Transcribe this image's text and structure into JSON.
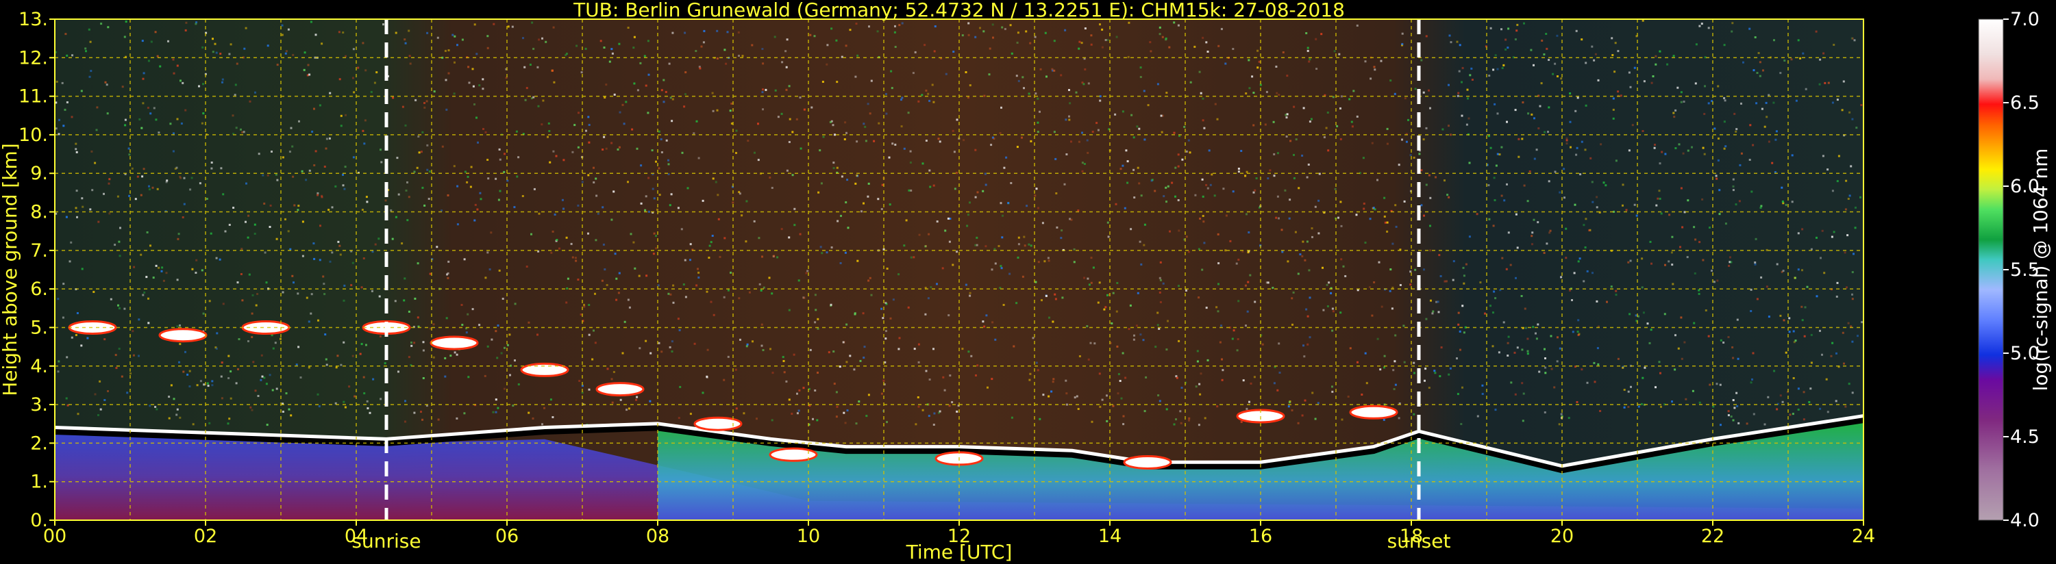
{
  "chart_data": {
    "type": "heatmap",
    "title": "TUB: Berlin Grunewald (Germany; 52.4732 N / 13.2251 E):    CHM15k: 27-08-2018",
    "xlabel": "Time [UTC]",
    "ylabel": "Height above ground [km]",
    "colorbar_label": "log(rc-signal) @ 1064 nm",
    "xlim": [
      0,
      24
    ],
    "ylim": [
      0,
      13
    ],
    "x_ticks": [
      "00",
      "02",
      "04",
      "06",
      "08",
      "10",
      "12",
      "14",
      "16",
      "18",
      "20",
      "22",
      "24"
    ],
    "y_ticks": [
      "0.",
      "1.",
      "2.",
      "3.",
      "4.",
      "5.",
      "6.",
      "7.",
      "8.",
      "9.",
      "10.",
      "11.",
      "12.",
      "13."
    ],
    "colorbar_range": [
      4.0,
      7.0
    ],
    "colorbar_ticks": [
      "4.0",
      "4.5",
      "5.0",
      "5.5",
      "6.0",
      "6.5",
      "7.0"
    ],
    "grid": true,
    "grid_color": "#d4c000",
    "text_color": "#ffff33",
    "background": "#000000",
    "events": [
      {
        "label": "sunrise",
        "time": 4.4
      },
      {
        "label": "sunset",
        "time": 18.1
      }
    ],
    "boundary_layer_top": [
      {
        "x": 0.0,
        "y": 2.3
      },
      {
        "x": 4.4,
        "y": 2.0
      },
      {
        "x": 6.5,
        "y": 2.3
      },
      {
        "x": 8.0,
        "y": 2.4
      },
      {
        "x": 9.5,
        "y": 2.0
      },
      {
        "x": 10.5,
        "y": 1.8
      },
      {
        "x": 12.0,
        "y": 1.8
      },
      {
        "x": 13.5,
        "y": 1.7
      },
      {
        "x": 14.5,
        "y": 1.4
      },
      {
        "x": 16.0,
        "y": 1.4
      },
      {
        "x": 17.5,
        "y": 1.8
      },
      {
        "x": 18.1,
        "y": 2.2
      },
      {
        "x": 20.0,
        "y": 1.3
      },
      {
        "x": 22.0,
        "y": 2.0
      },
      {
        "x": 24.0,
        "y": 2.6
      }
    ],
    "cloud_layer": [
      {
        "x": 0.5,
        "y": 5.0
      },
      {
        "x": 1.7,
        "y": 4.8
      },
      {
        "x": 2.8,
        "y": 5.0
      },
      {
        "x": 4.4,
        "y": 5.0
      },
      {
        "x": 5.3,
        "y": 4.6
      },
      {
        "x": 6.5,
        "y": 3.9
      },
      {
        "x": 7.5,
        "y": 3.4
      },
      {
        "x": 8.8,
        "y": 2.5
      },
      {
        "x": 9.8,
        "y": 1.7
      },
      {
        "x": 12.0,
        "y": 1.6
      },
      {
        "x": 14.5,
        "y": 1.5
      },
      {
        "x": 16.0,
        "y": 2.7
      },
      {
        "x": 17.5,
        "y": 2.8
      }
    ]
  }
}
